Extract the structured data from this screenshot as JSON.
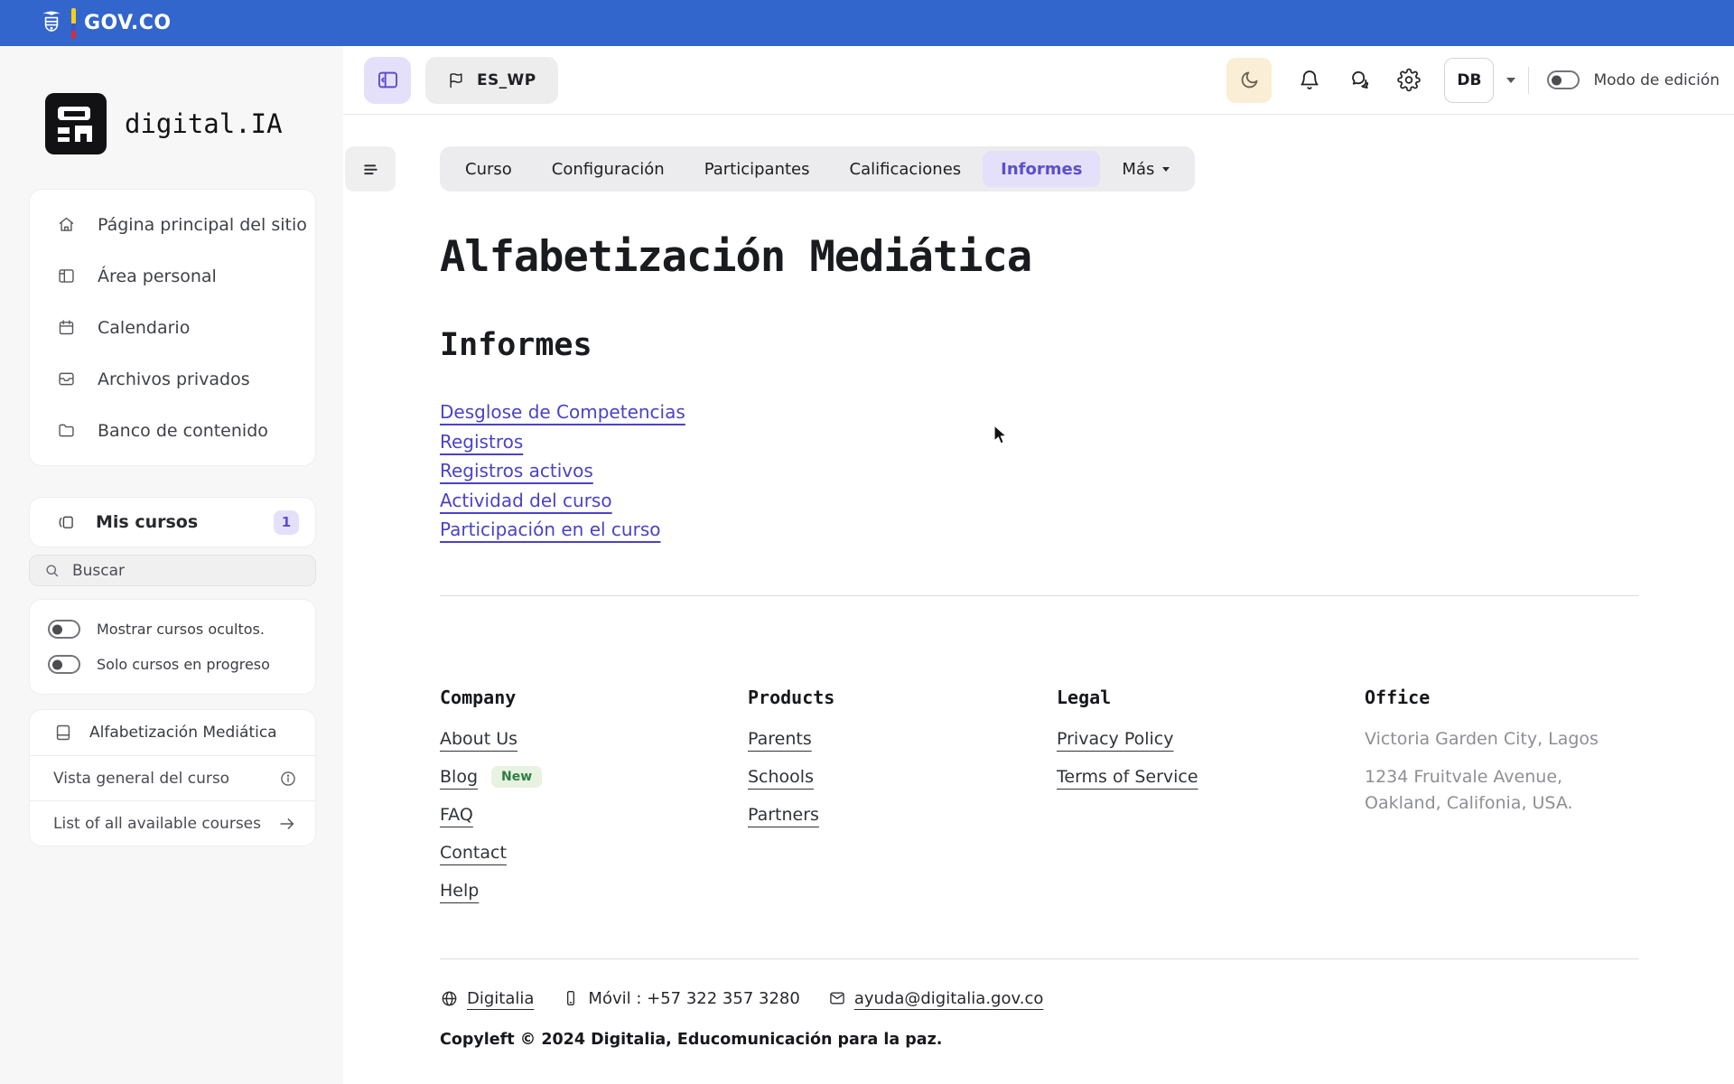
{
  "colors": {
    "brand-blue": "#3366cc",
    "accent": "#5b4fc9",
    "accent-bg": "#e5e0fa",
    "moon-bg": "#faeed6",
    "link": "#4b42c6",
    "badge-green-bg": "#e7f2e0",
    "badge-green-text": "#2e7d46"
  },
  "topbar": {
    "brand": "GOV.CO"
  },
  "sidebar": {
    "logo_text": "digital.IA",
    "nav": [
      {
        "label": "Página principal del sitio",
        "icon": "home-icon"
      },
      {
        "label": "Área personal",
        "icon": "dashboard-icon"
      },
      {
        "label": "Calendario",
        "icon": "calendar-icon"
      },
      {
        "label": "Archivos privados",
        "icon": "archive-icon"
      },
      {
        "label": "Banco de contenido",
        "icon": "folder-icon"
      }
    ],
    "my_courses_label": "Mis cursos",
    "my_courses_count": "1",
    "search_placeholder": "Buscar",
    "filter_hidden_label": "Mostrar cursos ocultos.",
    "filter_progress_label": "Solo cursos en progreso",
    "course_label": "Alfabetización Mediática",
    "overview_label": "Vista general del curso",
    "all_courses_label": "List of all available courses"
  },
  "header": {
    "language_label": "ES_WP",
    "avatar_initials": "DB",
    "edit_mode_label": "Modo de edición"
  },
  "tabs": [
    {
      "label": "Curso"
    },
    {
      "label": "Configuración"
    },
    {
      "label": "Participantes"
    },
    {
      "label": "Calificaciones"
    },
    {
      "label": "Informes"
    },
    {
      "label": "Más"
    }
  ],
  "content": {
    "title": "Alfabetización Mediática",
    "section_title": "Informes",
    "report_links": [
      "Desglose de Competencias",
      "Registros",
      "Registros activos",
      "Actividad del curso",
      "Participación en el curso"
    ]
  },
  "footer": {
    "company_title": "Company",
    "company_links": [
      "About Us",
      "Blog",
      "FAQ",
      "Contact",
      "Help"
    ],
    "blog_badge": "New",
    "products_title": "Products",
    "products_links": [
      "Parents",
      "Schools",
      "Partners"
    ],
    "legal_title": "Legal",
    "legal_links": [
      "Privacy Policy",
      "Terms of Service"
    ],
    "office_title": "Office",
    "office_lines": [
      "Victoria Garden City, Lagos",
      "1234 Fruitvale Avenue, Oakland, Califonia, USA."
    ],
    "site_link": "Digitalia",
    "phone": "Móvil : +57 322 357 3280",
    "email": "ayuda@digitalia.gov.co",
    "copyright": "Copyleft © 2024 Digitalia, Educomunicación para la paz."
  }
}
